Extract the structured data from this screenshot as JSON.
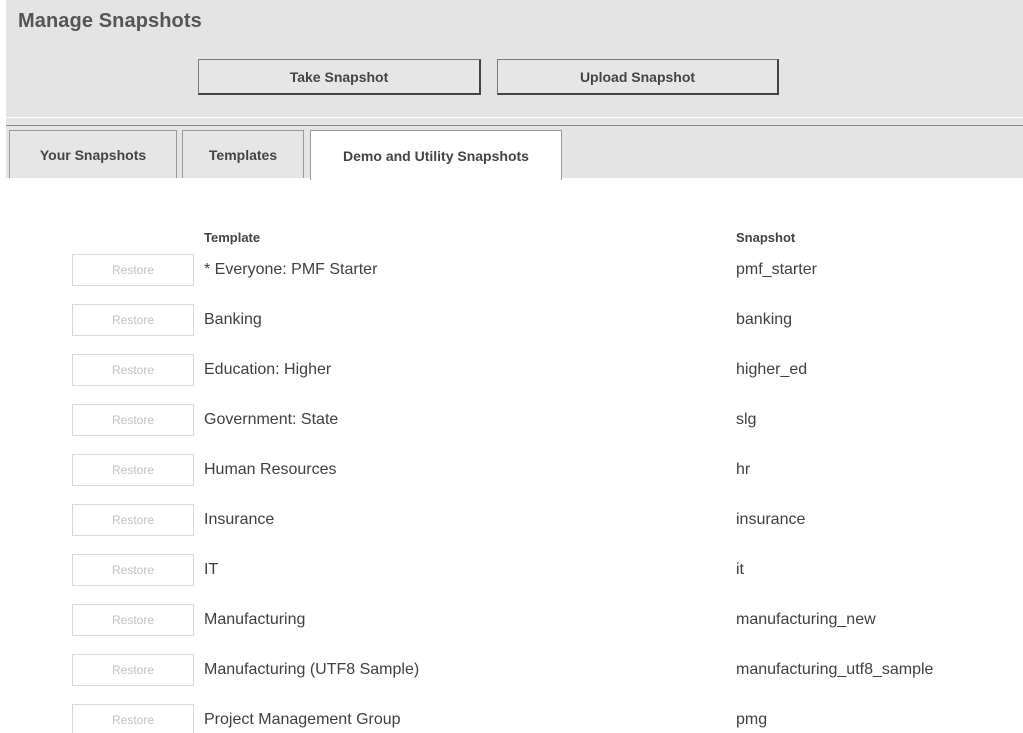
{
  "header": {
    "title": "Manage Snapshots",
    "take_snapshot_label": "Take Snapshot",
    "upload_snapshot_label": "Upload Snapshot"
  },
  "tabs": [
    {
      "label": "Your Snapshots",
      "active": false
    },
    {
      "label": "Templates",
      "active": false
    },
    {
      "label": "Demo and Utility Snapshots",
      "active": true
    }
  ],
  "table": {
    "columns": {
      "template": "Template",
      "snapshot": "Snapshot"
    },
    "restore_label": "Restore",
    "rows": [
      {
        "template": "* Everyone: PMF Starter",
        "snapshot": "pmf_starter"
      },
      {
        "template": "Banking",
        "snapshot": "banking"
      },
      {
        "template": "Education: Higher",
        "snapshot": "higher_ed"
      },
      {
        "template": "Government: State",
        "snapshot": "slg"
      },
      {
        "template": "Human Resources",
        "snapshot": "hr"
      },
      {
        "template": "Insurance",
        "snapshot": "insurance"
      },
      {
        "template": "IT",
        "snapshot": "it"
      },
      {
        "template": "Manufacturing",
        "snapshot": "manufacturing_new"
      },
      {
        "template": "Manufacturing (UTF8 Sample)",
        "snapshot": "manufacturing_utf8_sample"
      },
      {
        "template": "Project Management Group",
        "snapshot": "pmg"
      }
    ]
  }
}
